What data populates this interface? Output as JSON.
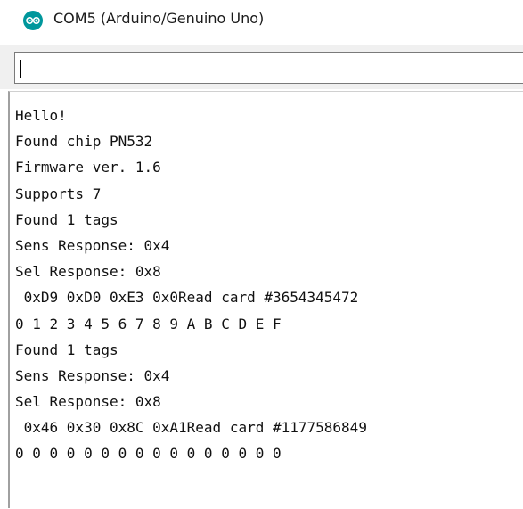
{
  "window": {
    "title": "COM5 (Arduino/Genuino Uno)",
    "icon": "arduino-icon",
    "accent_color": "#00979c"
  },
  "send_bar": {
    "input_value": ""
  },
  "serial_output": {
    "lines": [
      "Hello!",
      "Found chip PN532",
      "Firmware ver. 1.6",
      "Supports 7",
      "Found 1 tags",
      "Sens Response: 0x4",
      "Sel Response: 0x8",
      " 0xD9 0xD0 0xE3 0x0Read card #3654345472",
      "0 1 2 3 4 5 6 7 8 9 A B C D E F",
      "Found 1 tags",
      "Sens Response: 0x4",
      "Sel Response: 0x8",
      " 0x46 0x30 0x8C 0xA1Read card #1177586849",
      "0 0 0 0 0 0 0 0 0 0 0 0 0 0 0 0"
    ]
  }
}
